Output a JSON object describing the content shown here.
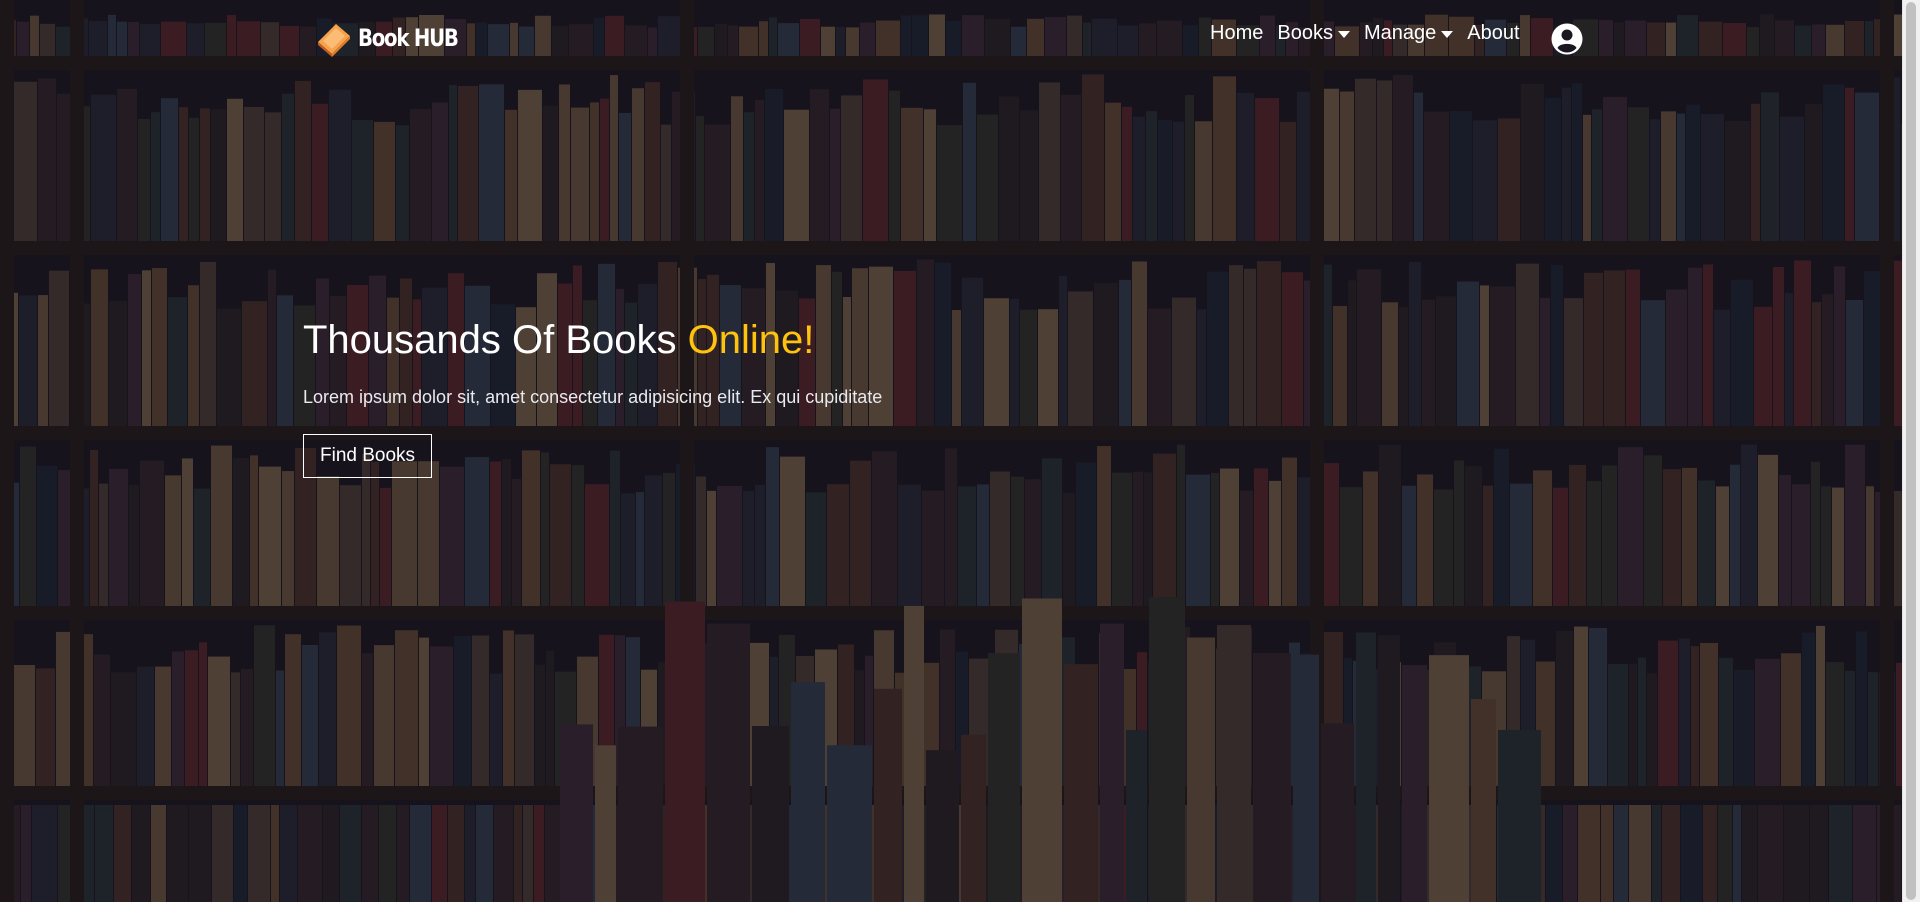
{
  "brand": {
    "name": "Book HUB",
    "icon": "book-logo-icon"
  },
  "nav": {
    "items": [
      {
        "label": "Home",
        "dropdown": false
      },
      {
        "label": "Books",
        "dropdown": true
      },
      {
        "label": "Manage",
        "dropdown": true
      },
      {
        "label": "About",
        "dropdown": false
      }
    ],
    "user_icon": "user-circle-icon"
  },
  "hero": {
    "title": "Thousands Of Books",
    "title_accent": "Online!",
    "subtitle": "Lorem ipsum dolor sit, amet consectetur adipisicing elit. Ex qui cupiditate",
    "button_label": "Find Books"
  },
  "colors": {
    "accent": "#ffc20e",
    "text": "#ffffff",
    "overlay": "#12101c"
  }
}
